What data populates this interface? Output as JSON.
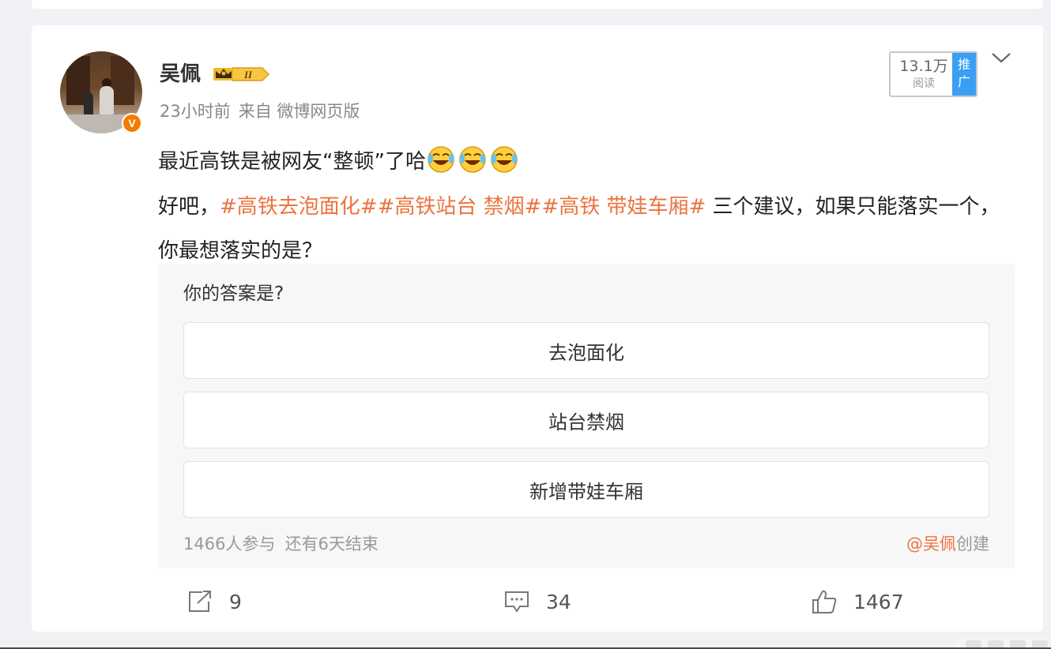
{
  "post": {
    "author": {
      "name": "吴佩",
      "verified_mark": "V",
      "level_badge": "II"
    },
    "time": "23小时前",
    "source": "来自 微博网页版",
    "stats_box": {
      "reads": "13.1万",
      "reads_label": "阅读",
      "promote_label": "推广"
    },
    "text": {
      "line1": "最近高铁是被网友“整顿”了哈",
      "line2_prefix": "好吧，",
      "hashtags": [
        "#高铁去泡面化#",
        "#高铁站台 禁烟#",
        "#高铁 带娃车厢#"
      ],
      "line2_suffix": " 三个建议，如果只能落实一个，你最想落实的是？"
    },
    "poll": {
      "question": "你的答案是?",
      "options": [
        "去泡面化",
        "站台禁烟",
        "新增带娃车厢"
      ],
      "participants": "1466人参与",
      "remaining": "还有6天结束",
      "creator_mention": "@吴佩",
      "creator_suffix": "创建"
    },
    "actions": {
      "share_count": "9",
      "comment_count": "34",
      "like_count": "1467"
    }
  },
  "colors": {
    "accent": "#eb7340",
    "promote": "#3a9ef5",
    "verified": "#f47b00"
  }
}
